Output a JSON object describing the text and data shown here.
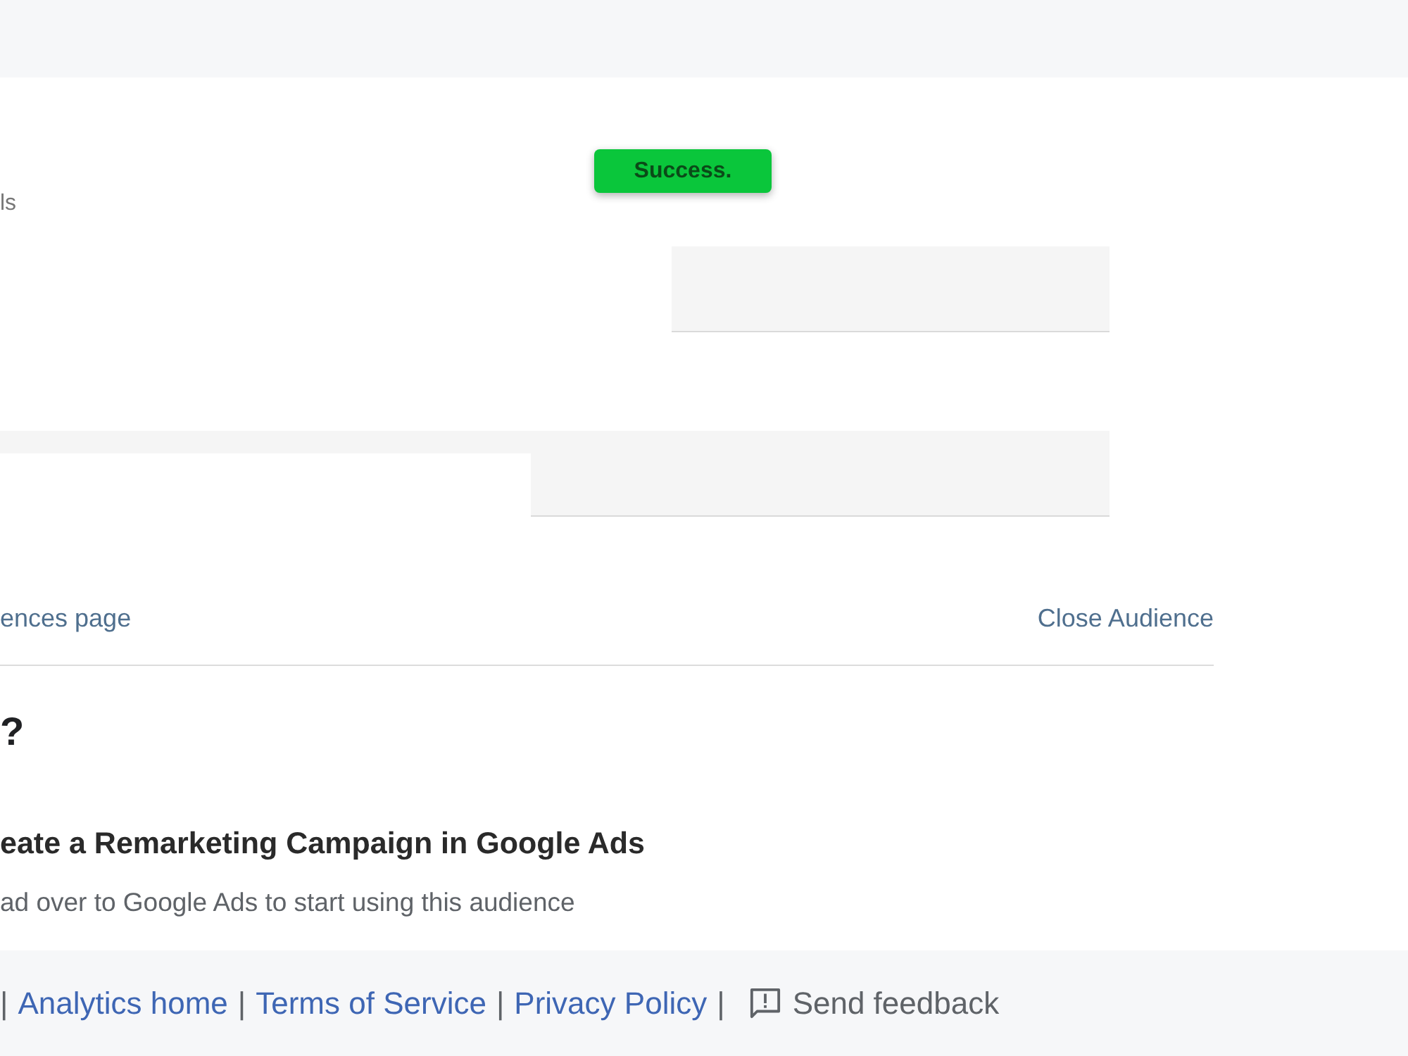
{
  "form": {
    "label": "ls"
  },
  "toast": {
    "text": "Success."
  },
  "actions": [
    {
      "text": "ences page"
    },
    {
      "text": "Close Audience"
    }
  ],
  "next_steps": {
    "heading": "?",
    "items": [
      {
        "title": "eate a Remarketing Campaign in Google Ads",
        "description": "ad over to Google Ads to start using this audience"
      }
    ]
  },
  "footer": {
    "items": [
      {
        "kind": "separator",
        "text": "|"
      },
      {
        "kind": "link",
        "text": "Analytics home"
      },
      {
        "kind": "separator",
        "text": "|"
      },
      {
        "kind": "link",
        "text": "Terms of Service"
      },
      {
        "kind": "separator",
        "text": "|"
      },
      {
        "kind": "link",
        "text": "Privacy Policy"
      },
      {
        "kind": "separator",
        "text": "|"
      },
      {
        "kind": "feedback",
        "text": "Send feedback"
      }
    ]
  }
}
